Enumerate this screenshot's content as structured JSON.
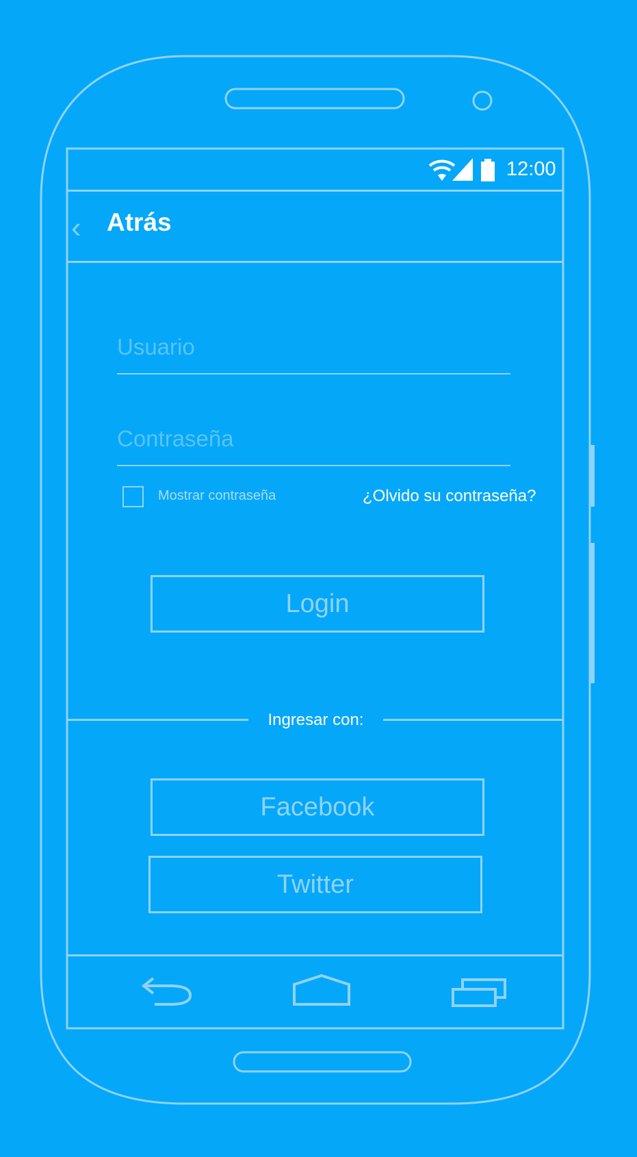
{
  "status_bar": {
    "time": "12:00",
    "icons": [
      "wifi-icon",
      "signal-icon",
      "battery-icon"
    ]
  },
  "app_bar": {
    "back_icon": "chevron-left-icon",
    "title": "Atrás"
  },
  "form": {
    "username_placeholder": "Usuario",
    "password_placeholder": "Contraseña",
    "show_password_label": "Mostrar contraseña",
    "forgot_password_link": "¿Olvido su contraseña?",
    "login_button": "Login"
  },
  "social": {
    "divider_label": "Ingresar con:",
    "facebook_button": "Facebook",
    "twitter_button": "Twitter"
  },
  "nav_bar": {
    "icons": [
      "back-nav-icon",
      "home-nav-icon",
      "recents-nav-icon"
    ]
  },
  "colors": {
    "background": "#05a7f9",
    "outline": "#8fd3f7",
    "text": "#ffffff",
    "placeholder": "#59c4f7"
  }
}
